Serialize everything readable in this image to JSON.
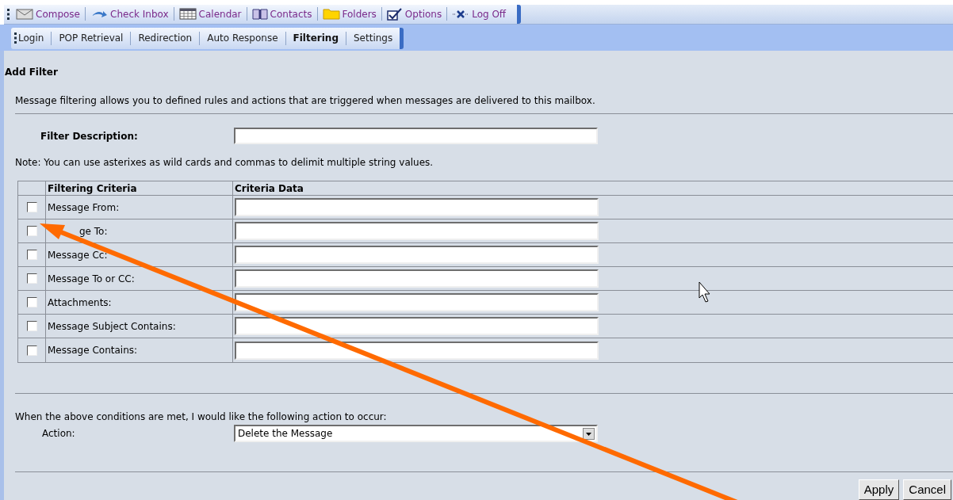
{
  "toolbar": [
    {
      "kind": "compose",
      "label": "Compose"
    },
    {
      "kind": "inbox",
      "label": "Check Inbox"
    },
    {
      "kind": "calendar",
      "label": "Calendar"
    },
    {
      "kind": "contacts",
      "label": "Contacts"
    },
    {
      "kind": "folders",
      "label": "Folders"
    },
    {
      "kind": "options",
      "label": "Options"
    },
    {
      "kind": "logoff",
      "label": "Log Off"
    }
  ],
  "tabs": [
    {
      "label": "Login",
      "selected": false
    },
    {
      "label": "POP Retrieval",
      "selected": false
    },
    {
      "label": "Redirection",
      "selected": false
    },
    {
      "label": "Auto Response",
      "selected": false
    },
    {
      "label": "Filtering",
      "selected": true
    },
    {
      "label": "Settings",
      "selected": false
    }
  ],
  "heading": "Add Filter",
  "intro": "Message filtering allows you to defined rules and actions that are triggered when messages are delivered to this mailbox.",
  "description_label": "Filter Description:",
  "note": "Note: You can use asterixes as wild cards and commas to delimit multiple string values.",
  "criteria": {
    "columns": [
      "Filtering Criteria",
      "Criteria Data"
    ],
    "rows": [
      {
        "label": "Message From:",
        "checked": false
      },
      {
        "label": "ge To:",
        "checked": false,
        "obscured": true
      },
      {
        "label": "Message Cc:",
        "checked": false
      },
      {
        "label": "Message To or CC:",
        "checked": false
      },
      {
        "label": "Attachments:",
        "checked": false
      },
      {
        "label": "Message Subject Contains:",
        "checked": false
      },
      {
        "label": "Message Contains:",
        "checked": false
      }
    ]
  },
  "action_intro": "When the above conditions are met, I would like the following action to occur:",
  "action_label": "Action:",
  "action_value": "Delete the Message",
  "buttons": [
    "Apply",
    "Cancel"
  ]
}
